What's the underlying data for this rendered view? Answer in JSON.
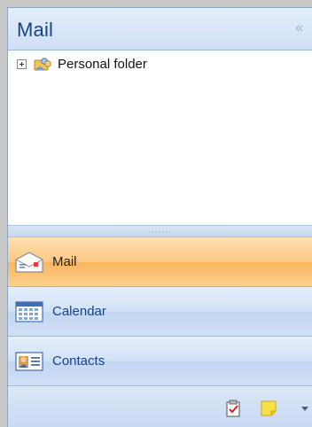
{
  "header": {
    "title": "Mail",
    "collapse_glyph": "«"
  },
  "tree": {
    "items": [
      {
        "label": "Personal folder",
        "icon": "personal-folders-icon"
      }
    ]
  },
  "splitter": {
    "grip": "·······"
  },
  "nav": [
    {
      "label": "Mail",
      "icon": "mail-icon",
      "active": true
    },
    {
      "label": "Calendar",
      "icon": "calendar-icon",
      "active": false
    },
    {
      "label": "Contacts",
      "icon": "contacts-icon",
      "active": false
    }
  ],
  "bottombar": {
    "icons": [
      "tasks-icon",
      "notes-icon",
      "configure-buttons-icon"
    ]
  },
  "colors": {
    "accent": "#15428b",
    "active_tab": "#fbc982",
    "pane_border": "#8aa6c8"
  }
}
